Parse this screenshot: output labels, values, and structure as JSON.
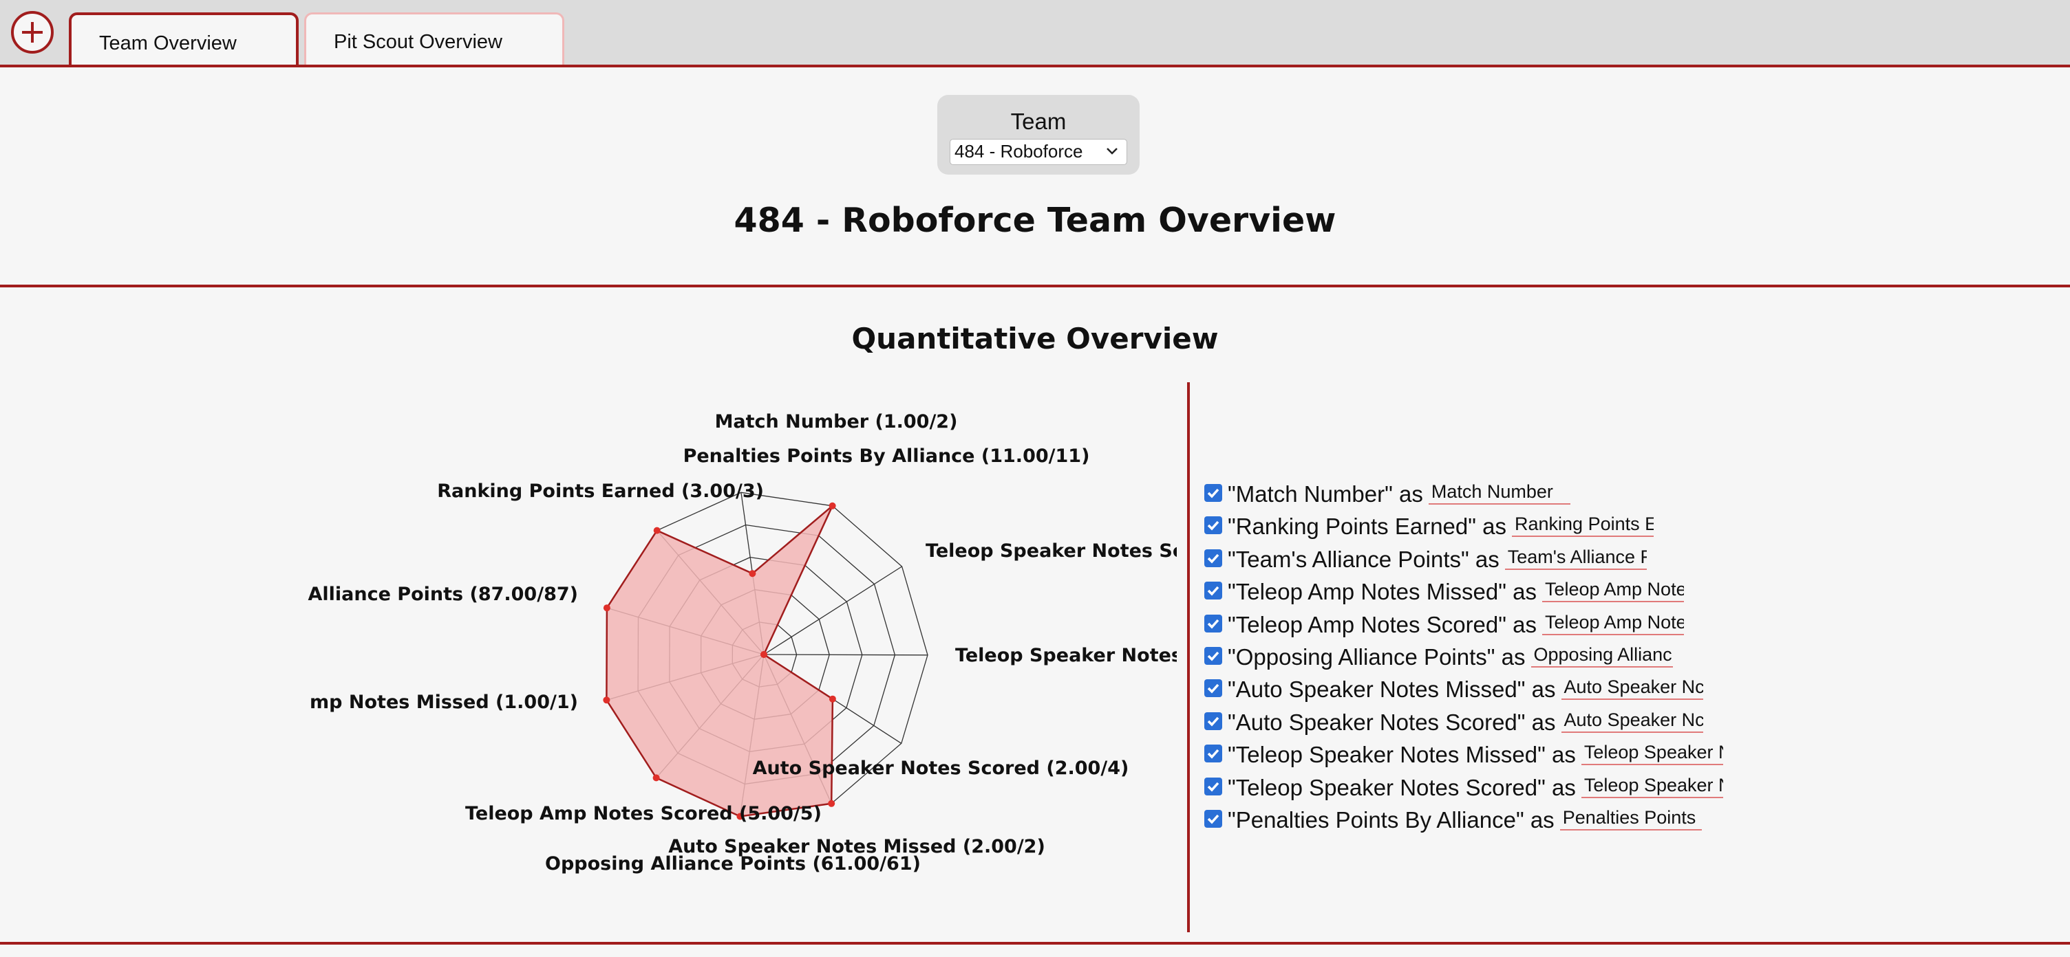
{
  "tabs": [
    {
      "label": "Team Overview"
    },
    {
      "label": "Pit Scout Overview"
    }
  ],
  "header": {
    "team_label": "Team",
    "team_selected": "484 - Roboforce",
    "title": "484 - Roboforce Team Overview"
  },
  "quantitative": {
    "section_title": "Quantitative Overview"
  },
  "chart_data": {
    "type": "radar",
    "title": "",
    "axes": [
      {
        "label": "Match Number (1.00/2)",
        "value": 1.0,
        "max": 2
      },
      {
        "label": "Penalties Points By Alliance (11.00/11)",
        "value": 11.0,
        "max": 11
      },
      {
        "label": "Teleop Speaker Notes Score",
        "value": 0.0,
        "max": 1
      },
      {
        "label": "Teleop Speaker Notes M",
        "value": 0.0,
        "max": 1
      },
      {
        "label": "Auto Speaker Notes Scored (2.00/4)",
        "value": 2.0,
        "max": 4
      },
      {
        "label": "Auto Speaker Notes Missed (2.00/2)",
        "value": 2.0,
        "max": 2
      },
      {
        "label": "Opposing Alliance Points (61.00/61)",
        "value": 61.0,
        "max": 61
      },
      {
        "label": "Teleop Amp Notes Scored (5.00/5)",
        "value": 5.0,
        "max": 5
      },
      {
        "label": "mp Notes Missed (1.00/1)",
        "value": 1.0,
        "max": 1
      },
      {
        "label": "Alliance Points (87.00/87)",
        "value": 87.0,
        "max": 87
      },
      {
        "label": "Ranking Points Earned (3.00/3)",
        "value": 3.0,
        "max": 3
      }
    ],
    "fill_color": "#f2b5b5",
    "stroke_color": "#a11d1d",
    "point_color": "#e0302a",
    "grid_levels": 5
  },
  "fields": [
    {
      "label": "\"Match Number\" as",
      "value": "Match Number",
      "checked": true
    },
    {
      "label": "\"Ranking Points Earned\" as",
      "value": "Ranking Points E",
      "checked": true
    },
    {
      "label": "\"Team's Alliance Points\" as",
      "value": "Team's Alliance F",
      "checked": true
    },
    {
      "label": "\"Teleop Amp Notes Missed\" as",
      "value": "Teleop Amp Note",
      "checked": true
    },
    {
      "label": "\"Teleop Amp Notes Scored\" as",
      "value": "Teleop Amp Note",
      "checked": true
    },
    {
      "label": "\"Opposing Alliance Points\" as",
      "value": "Opposing Allianc",
      "checked": true
    },
    {
      "label": "\"Auto Speaker Notes Missed\" as",
      "value": "Auto Speaker Nc",
      "checked": true
    },
    {
      "label": "\"Auto Speaker Notes Scored\" as",
      "value": "Auto Speaker Nc",
      "checked": true
    },
    {
      "label": "\"Teleop Speaker Notes Missed\" as",
      "value": "Teleop Speaker N",
      "checked": true
    },
    {
      "label": "\"Teleop Speaker Notes Scored\" as",
      "value": "Teleop Speaker N",
      "checked": true
    },
    {
      "label": "\"Penalties Points By Alliance\" as",
      "value": "Penalties Points",
      "checked": true
    }
  ],
  "icons": {
    "add_tab": "plus-circle-icon",
    "checkbox": "checkmark-icon",
    "dropdown": "chevron-down-icon"
  }
}
